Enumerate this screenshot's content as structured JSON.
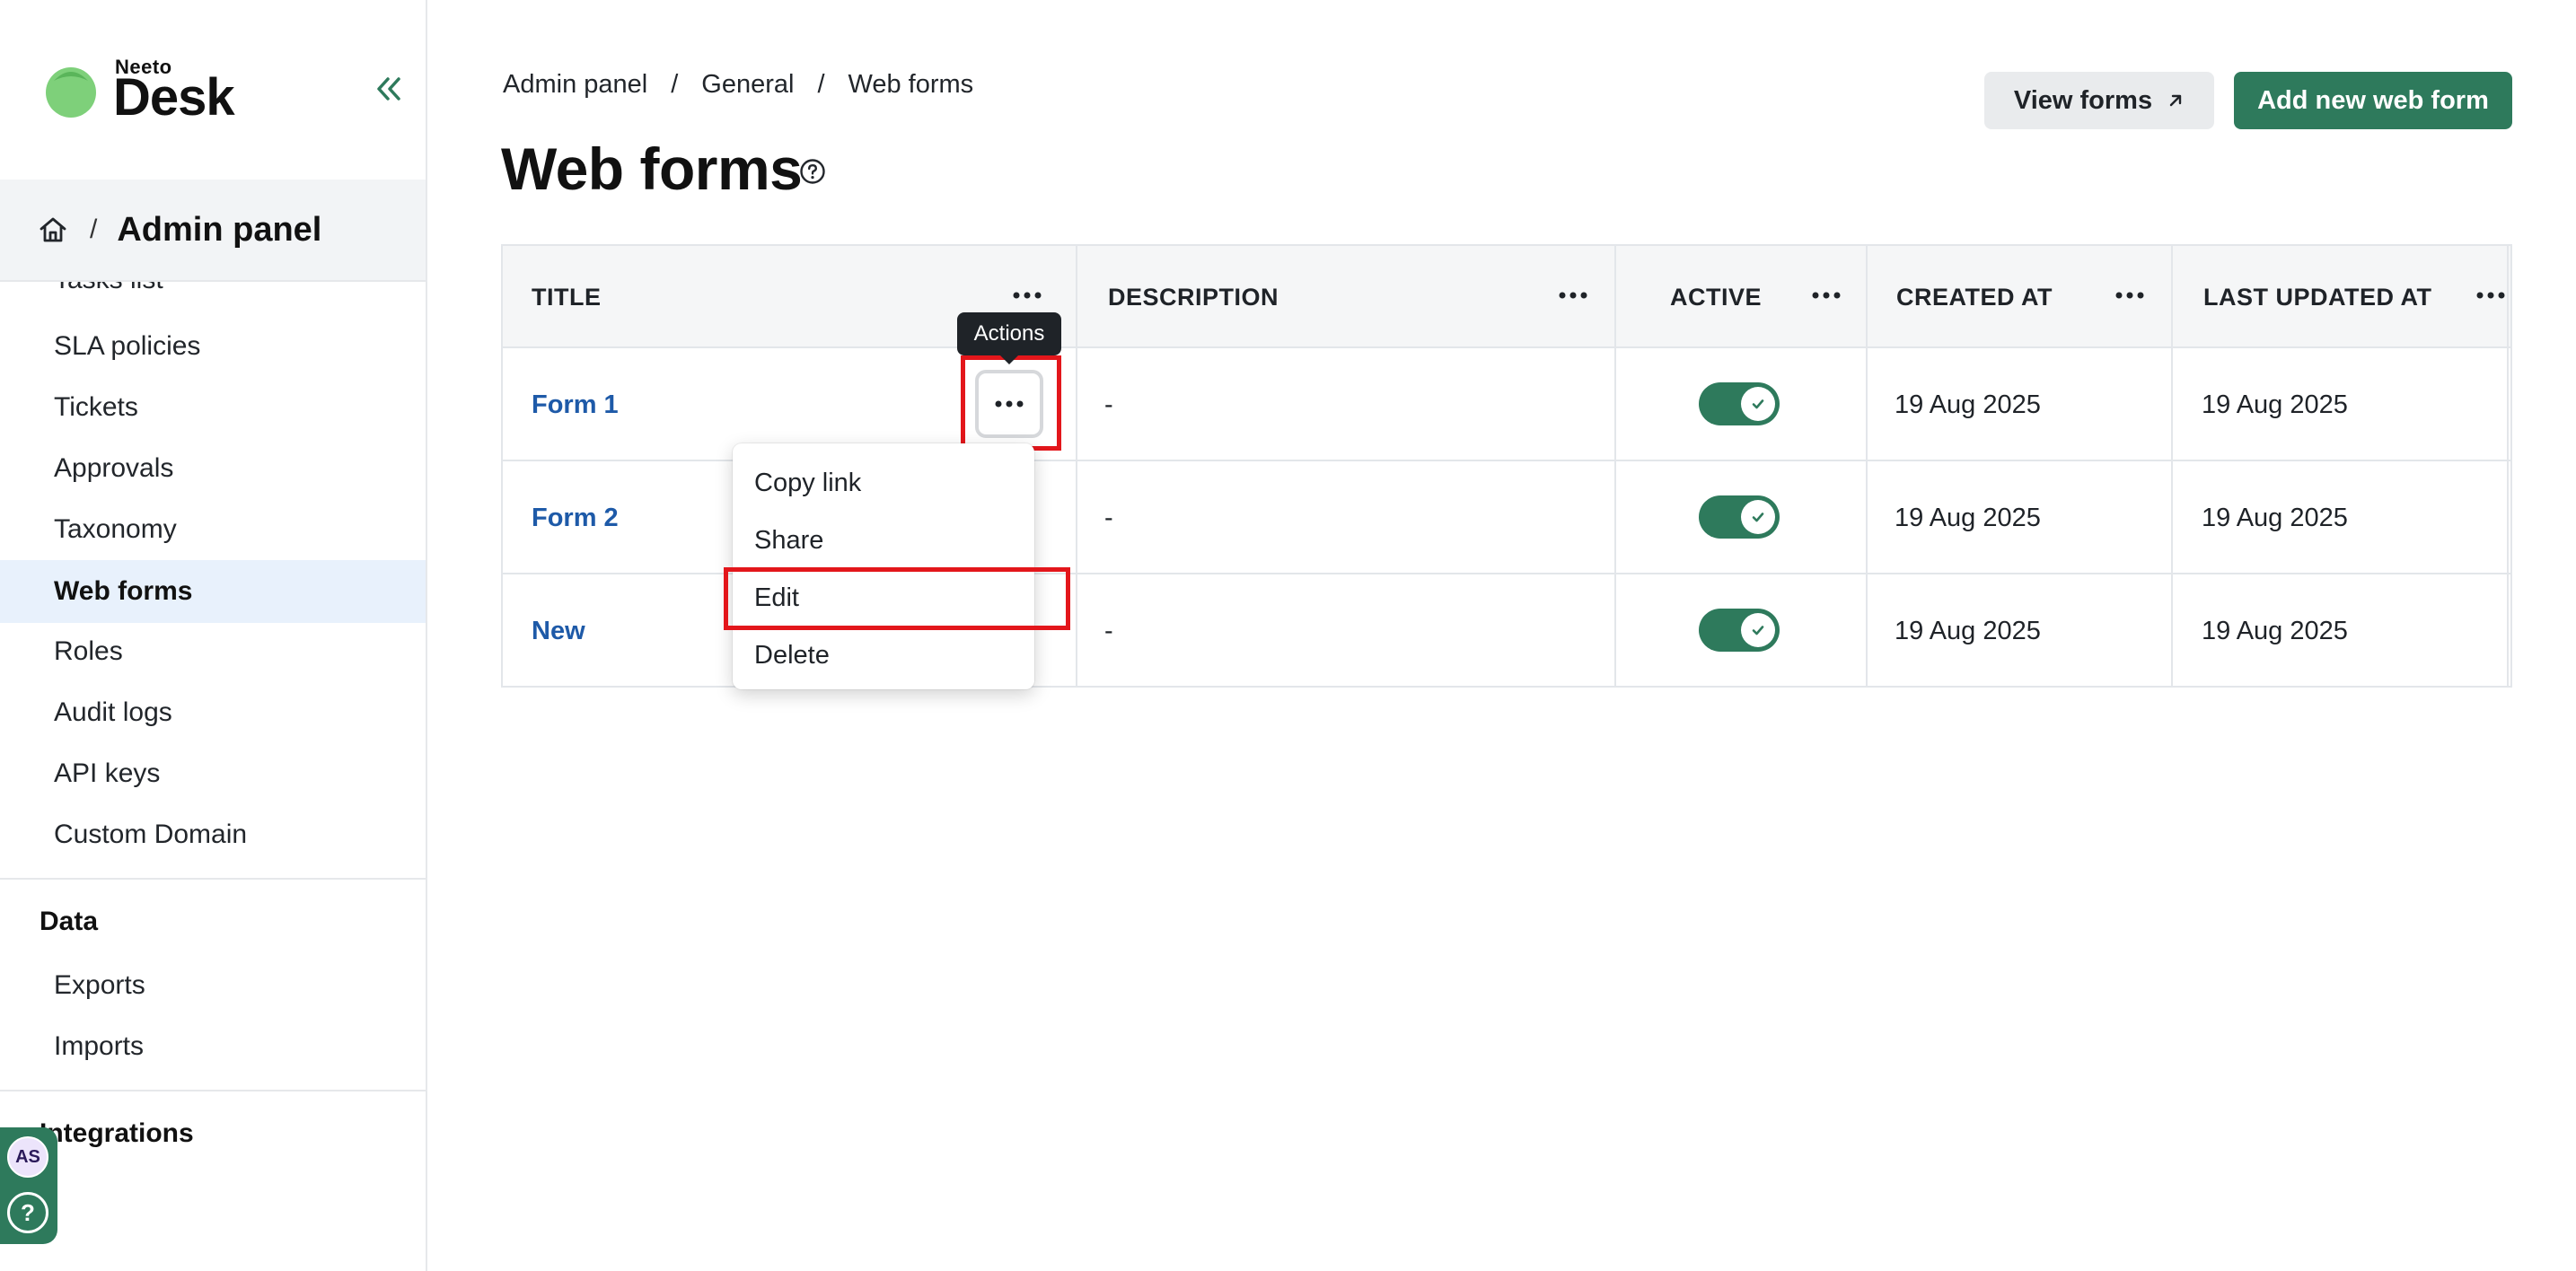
{
  "app": {
    "brand_small": "Neeto",
    "brand_big": "Desk"
  },
  "sidebar": {
    "crumb_title": "Admin panel",
    "crumb_sep": "/",
    "items": [
      {
        "label": "Tasks list"
      },
      {
        "label": "SLA policies"
      },
      {
        "label": "Tickets"
      },
      {
        "label": "Approvals"
      },
      {
        "label": "Taxonomy"
      },
      {
        "label": "Web forms",
        "active": true
      },
      {
        "label": "Roles"
      },
      {
        "label": "Audit logs"
      },
      {
        "label": "API keys"
      },
      {
        "label": "Custom Domain"
      }
    ],
    "data_group": "Data",
    "data_items": [
      {
        "label": "Exports"
      },
      {
        "label": "Imports"
      }
    ],
    "integrations_group": "Integrations",
    "user_initials": "AS",
    "help_glyph": "?"
  },
  "breadcrumb": [
    "Admin panel",
    "General",
    "Web forms"
  ],
  "breadcrumb_sep": "/",
  "page_title": "Web forms",
  "buttons": {
    "view_forms": "View forms",
    "add_new": "Add new web form"
  },
  "table": {
    "headers": [
      "TITLE",
      "DESCRIPTION",
      "ACTIVE",
      "CREATED AT",
      "LAST UPDATED AT"
    ],
    "rows": [
      {
        "title": "Form 1",
        "description": "-",
        "active": true,
        "created_at": "19 Aug 2025",
        "updated_at": "19 Aug 2025"
      },
      {
        "title": "Form 2",
        "description": "-",
        "active": true,
        "created_at": "19 Aug 2025",
        "updated_at": "19 Aug 2025"
      },
      {
        "title": "New",
        "description": "-",
        "active": true,
        "created_at": "19 Aug 2025",
        "updated_at": "19 Aug 2025"
      }
    ]
  },
  "tooltip": "Actions",
  "menu": [
    "Copy link",
    "Share",
    "Edit",
    "Delete"
  ],
  "colors": {
    "accent": "#2e7a5c",
    "link": "#1e5aa8",
    "highlight": "#e3161b",
    "active_nav": "#e8f1fc"
  }
}
